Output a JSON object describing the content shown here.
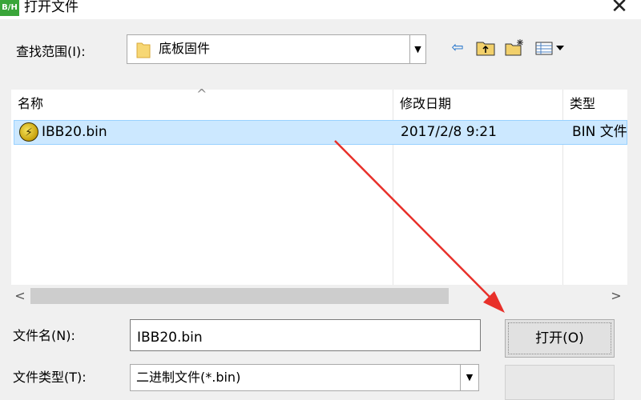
{
  "window": {
    "title": "打开文件",
    "app_icon_text": "B/H",
    "close_glyph": "✕"
  },
  "look_in": {
    "label": "查找范围(I):",
    "value": "底板固件"
  },
  "toolbar": {
    "back": "⇦",
    "up": "↑",
    "new_folder": "✱",
    "view": "▦▾"
  },
  "list": {
    "columns": [
      "名称",
      "修改日期",
      "类型"
    ],
    "sort_indicator": "^",
    "rows": [
      {
        "name": "IBB20.bin",
        "date": "2017/2/8 9:21",
        "type": "BIN 文件",
        "icon": "bin-file-icon",
        "selected": true
      }
    ]
  },
  "scrollbar": {
    "left": "<",
    "right": ">"
  },
  "file_name": {
    "label": "文件名(N):",
    "value": "IBB20.bin"
  },
  "file_type": {
    "label": "文件类型(T):",
    "value": "二进制文件(*.bin)"
  },
  "buttons": {
    "open": "打开(O)"
  },
  "colors": {
    "selection": "#cce8ff",
    "annotation_arrow": "#e8302a"
  }
}
